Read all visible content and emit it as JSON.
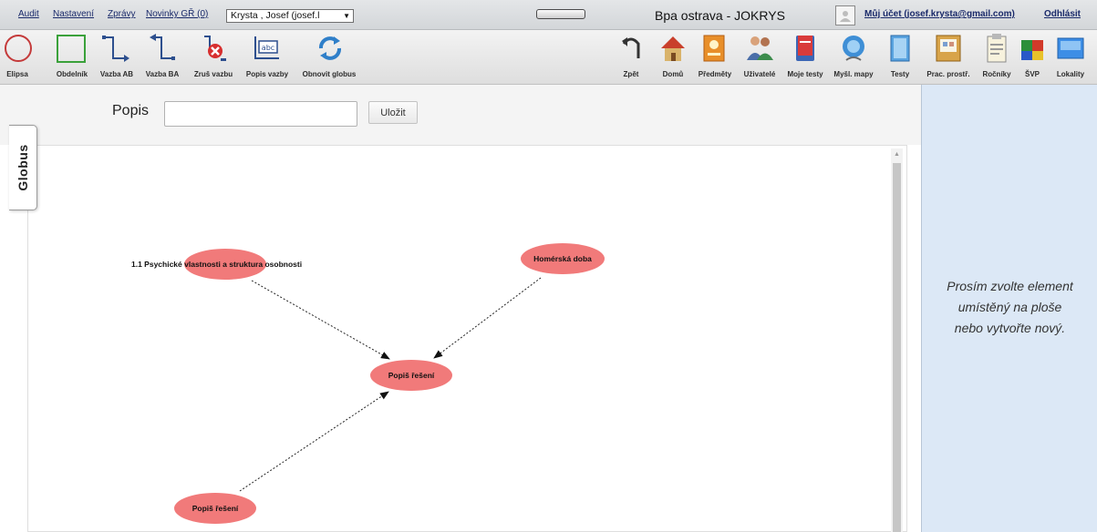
{
  "topbar": {
    "links": [
      "Audit",
      "Nastavení",
      "Zprávy",
      "Novinky GŘ (0)"
    ],
    "user_select": "Krysta , Josef (josef.l",
    "title": "Bpa ostrava - JOKRYS",
    "account_link": "Můj účet (josef.krysta@gmail.com)",
    "logout_link": "Odhlásit"
  },
  "toolbar": {
    "left_tools": [
      "Elipsa",
      "Obdelník",
      "Vazba AB",
      "Vazba BA",
      "Zruš vazbu",
      "Popis vazby",
      "Obnovit globus"
    ],
    "right_tools": [
      "Zpět",
      "Domů",
      "Předměty",
      "Uživatelé",
      "Moje testy",
      "Myšl. mapy",
      "Testy",
      "Prac. prostř.",
      "Ročníky",
      "ŠVP",
      "Lokality"
    ]
  },
  "editor": {
    "label": "Popis",
    "input_value": "",
    "save_label": "Uložit"
  },
  "side_tab": {
    "label": "Globus"
  },
  "mindmap": {
    "nodes": [
      {
        "id": "n1",
        "label": "1.1 Psychické vlastnosti a struktura osobnosti"
      },
      {
        "id": "n2",
        "label": "Homérská doba"
      },
      {
        "id": "n3",
        "label": "Popiš řešení"
      },
      {
        "id": "n4",
        "label": "Popiš řešení"
      }
    ],
    "node_color": "#f17a7a",
    "edges": [
      {
        "from": "n1",
        "to": "n3"
      },
      {
        "from": "n2",
        "to": "n3"
      },
      {
        "from": "n4",
        "to": "n3"
      }
    ]
  },
  "right_panel": {
    "message_lines": [
      "Prosím zvolte element",
      "umístěný na ploše",
      "nebo vytvořte nový."
    ]
  }
}
